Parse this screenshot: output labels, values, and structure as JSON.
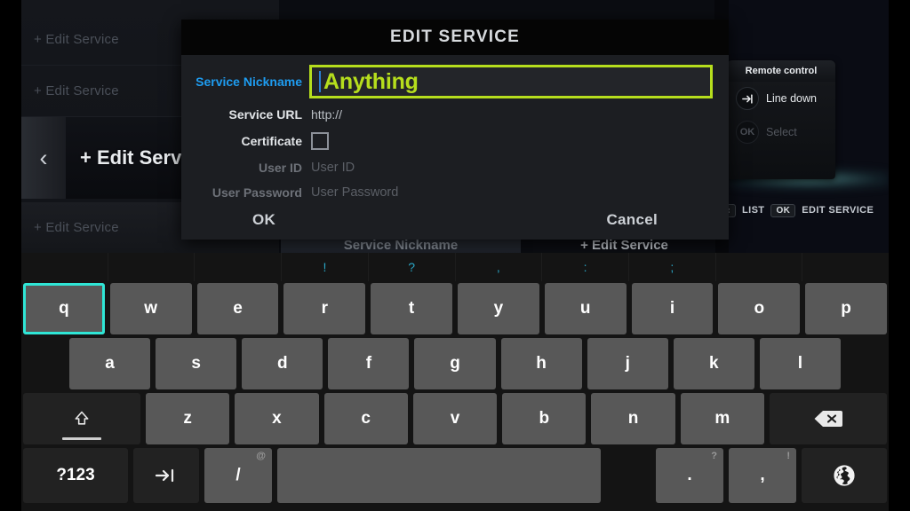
{
  "background": {
    "list_items": [
      {
        "label": "+ Edit Service"
      },
      {
        "label": "+ Edit Service"
      },
      {
        "label": "+ Edit Service"
      },
      {
        "label": "+ Edit Service"
      }
    ],
    "selected_label": "+ Edit Service",
    "back_chevron": "‹",
    "behind_dialog_left": "Service Nickname",
    "behind_dialog_right": "+ Edit Service"
  },
  "remote_control": {
    "title": "Remote control",
    "items": [
      {
        "button": "→|",
        "label": "Line down",
        "enabled": true
      },
      {
        "button": "OK",
        "label": "Select",
        "enabled": false
      }
    ]
  },
  "statusbar": {
    "back_key": "‹",
    "back_label": "LIST",
    "ok_key": "OK",
    "ok_label": "EDIT SERVICE"
  },
  "dialog": {
    "title": "EDIT SERVICE",
    "fields": [
      {
        "label": "Service Nickname",
        "value": "Anything",
        "state": "active"
      },
      {
        "label": "Service URL",
        "value": "http://",
        "state": "normal"
      },
      {
        "label": "Certificate",
        "value": "",
        "state": "checkbox",
        "checked": false
      },
      {
        "label": "User ID",
        "value": "User ID",
        "state": "disabled"
      },
      {
        "label": "User Password",
        "value": "User Password",
        "state": "disabled"
      }
    ],
    "ok_label": "OK",
    "cancel_label": "Cancel",
    "accent_color": "#b6de1d",
    "active_label_color": "#1e9cf0"
  },
  "keyboard": {
    "highlight_color": "#2fe6d6",
    "symbol_row": [
      "",
      "",
      "",
      "!",
      "?",
      ",",
      ":",
      ";",
      "",
      ""
    ],
    "row1": [
      "q",
      "w",
      "e",
      "r",
      "t",
      "y",
      "u",
      "i",
      "o",
      "p"
    ],
    "row1_selected": "q",
    "row2": [
      "a",
      "s",
      "d",
      "f",
      "g",
      "h",
      "j",
      "k",
      "l"
    ],
    "row3": [
      "z",
      "x",
      "c",
      "v",
      "b",
      "n",
      "m"
    ],
    "shift_key": "shift-icon",
    "backspace_key": "backspace-icon",
    "row4": [
      {
        "label": "?123",
        "sup": "",
        "name": "symbols-key"
      },
      {
        "label": "tab-icon",
        "sup": "",
        "name": "tab-key"
      },
      {
        "label": "/",
        "sup": "@",
        "name": "slash-key"
      },
      {
        "label": "",
        "sup": "",
        "name": "space-key"
      },
      {
        "label": ".",
        "sup": "?",
        "name": "period-key"
      },
      {
        "label": ",",
        "sup": "!",
        "name": "comma-key"
      },
      {
        "label": "globe-icon",
        "sup": "",
        "name": "language-key"
      }
    ]
  }
}
